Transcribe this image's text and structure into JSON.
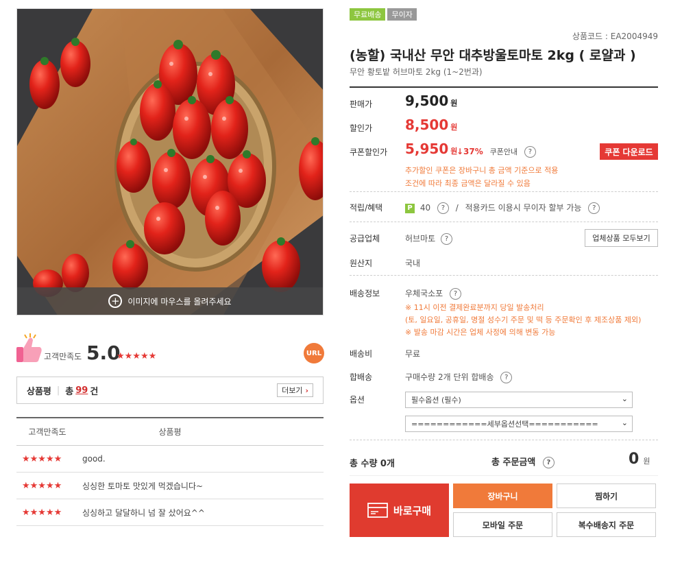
{
  "image": {
    "hover_text": "이미지에 마우스를 올려주세요"
  },
  "satisfaction": {
    "label": "고객만족도",
    "score": "5.0",
    "stars": "★★★★★",
    "url_label": "URL"
  },
  "reviews_box": {
    "title": "상품평",
    "total_prefix": "총",
    "count": "99",
    "unit": "건",
    "more_label": "더보기"
  },
  "review_table": {
    "headers": [
      "고객만족도",
      "상품평"
    ],
    "rows": [
      {
        "stars": "★★★★★",
        "text": "good."
      },
      {
        "stars": "★★★★★",
        "text": "싱싱한 토마토 맛있게 먹겠습니다~"
      },
      {
        "stars": "★★★★★",
        "text": "싱싱하고 달달하니 넘 잘 샀어요^^"
      }
    ]
  },
  "badges": [
    "무료배송",
    "무이자"
  ],
  "product": {
    "code": "상품코드 : EA2004949",
    "title": "(농할) 국내산 무안 대추방울토마토 2kg ( 로얄과 )",
    "subtitle": "무안 황토밭 허브마토 2kg (1~2번과)"
  },
  "price": {
    "sale_label": "판매가",
    "sale_value": "9,500",
    "discount_label": "할인가",
    "discount_value": "8,500",
    "coupon_label": "쿠폰할인가",
    "coupon_value": "5,950",
    "won": "원",
    "percent": "↓37%",
    "coupon_guide": "쿠폰안내",
    "coupon_button": "쿠폰 다운로드",
    "note1": "추가할인 쿠폰은 장바구니 총 금액 기준으로 적용",
    "note2": "조건에 따라 최종 금액은 달라질 수 있음"
  },
  "benefit": {
    "label": "적립/혜택",
    "points_badge": "P",
    "points": "40",
    "slash": "/",
    "card_text": "적용카드 이용시 무이자 할부 가능"
  },
  "supplier": {
    "label": "공급업체",
    "value": "허브마토",
    "button": "업체상품 모두보기"
  },
  "origin": {
    "label": "원산지",
    "value": "국내"
  },
  "shipping": {
    "label": "배송정보",
    "value": "우체국소포",
    "note1": "※ 11시 이전 결제완료분까지 당일 발송처리",
    "note2": "(토, 일요일, 공휴일, 명절 성수기 주문 및 떡 등 주문확인 후 제조상품 제외)",
    "note3": "※ 발송 마감 시간은 업체 사정에 의해 변동 가능"
  },
  "fee": {
    "label": "배송비",
    "value": "무료"
  },
  "combined": {
    "label": "합배송",
    "value": "구매수량 2개 단위 합배송"
  },
  "option": {
    "label": "옵션",
    "select1": "필수옵션 (필수)",
    "select2": "============세부옵션선택==========="
  },
  "totals": {
    "qty": "총 수량 0개",
    "order_label": "총 주문금액",
    "amount": "0",
    "won": "원"
  },
  "actions": {
    "buy_now": "바로구매",
    "cart": "장바구니",
    "wish": "찜하기",
    "mobile": "모바일 주문",
    "multi": "복수배송지 주문"
  }
}
